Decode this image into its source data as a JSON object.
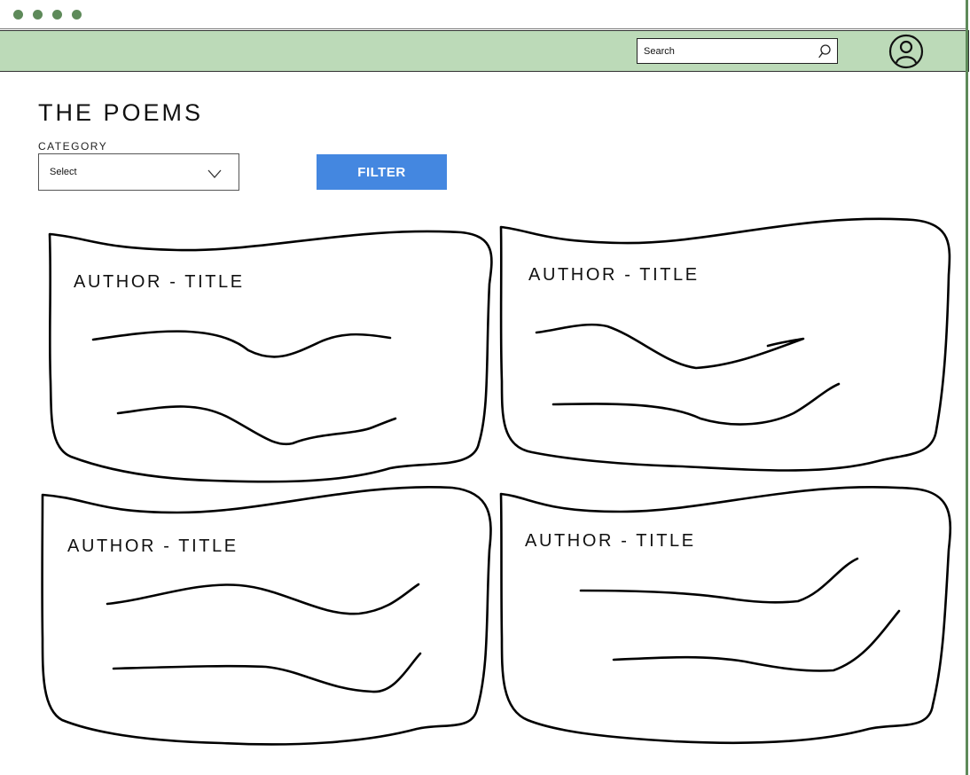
{
  "header": {
    "search": {
      "placeholder": "Search",
      "icon": "search-icon"
    },
    "avatar_icon": "user-circle-icon"
  },
  "main": {
    "title": "THE POEMS",
    "category": {
      "label": "CATEGORY",
      "selected": "Select",
      "icon": "chevron-down-icon"
    },
    "filter_button": "FILTER"
  },
  "cards": [
    {
      "title": "AUTHOR - TITLE"
    },
    {
      "title": "AUTHOR - TITLE"
    },
    {
      "title": "AUTHOR - TITLE"
    },
    {
      "title": "AUTHOR - TITLE"
    }
  ],
  "colors": {
    "header_bg": "#bcdab8",
    "accent_green": "#5e8a5a",
    "button_blue": "#4487e0"
  }
}
